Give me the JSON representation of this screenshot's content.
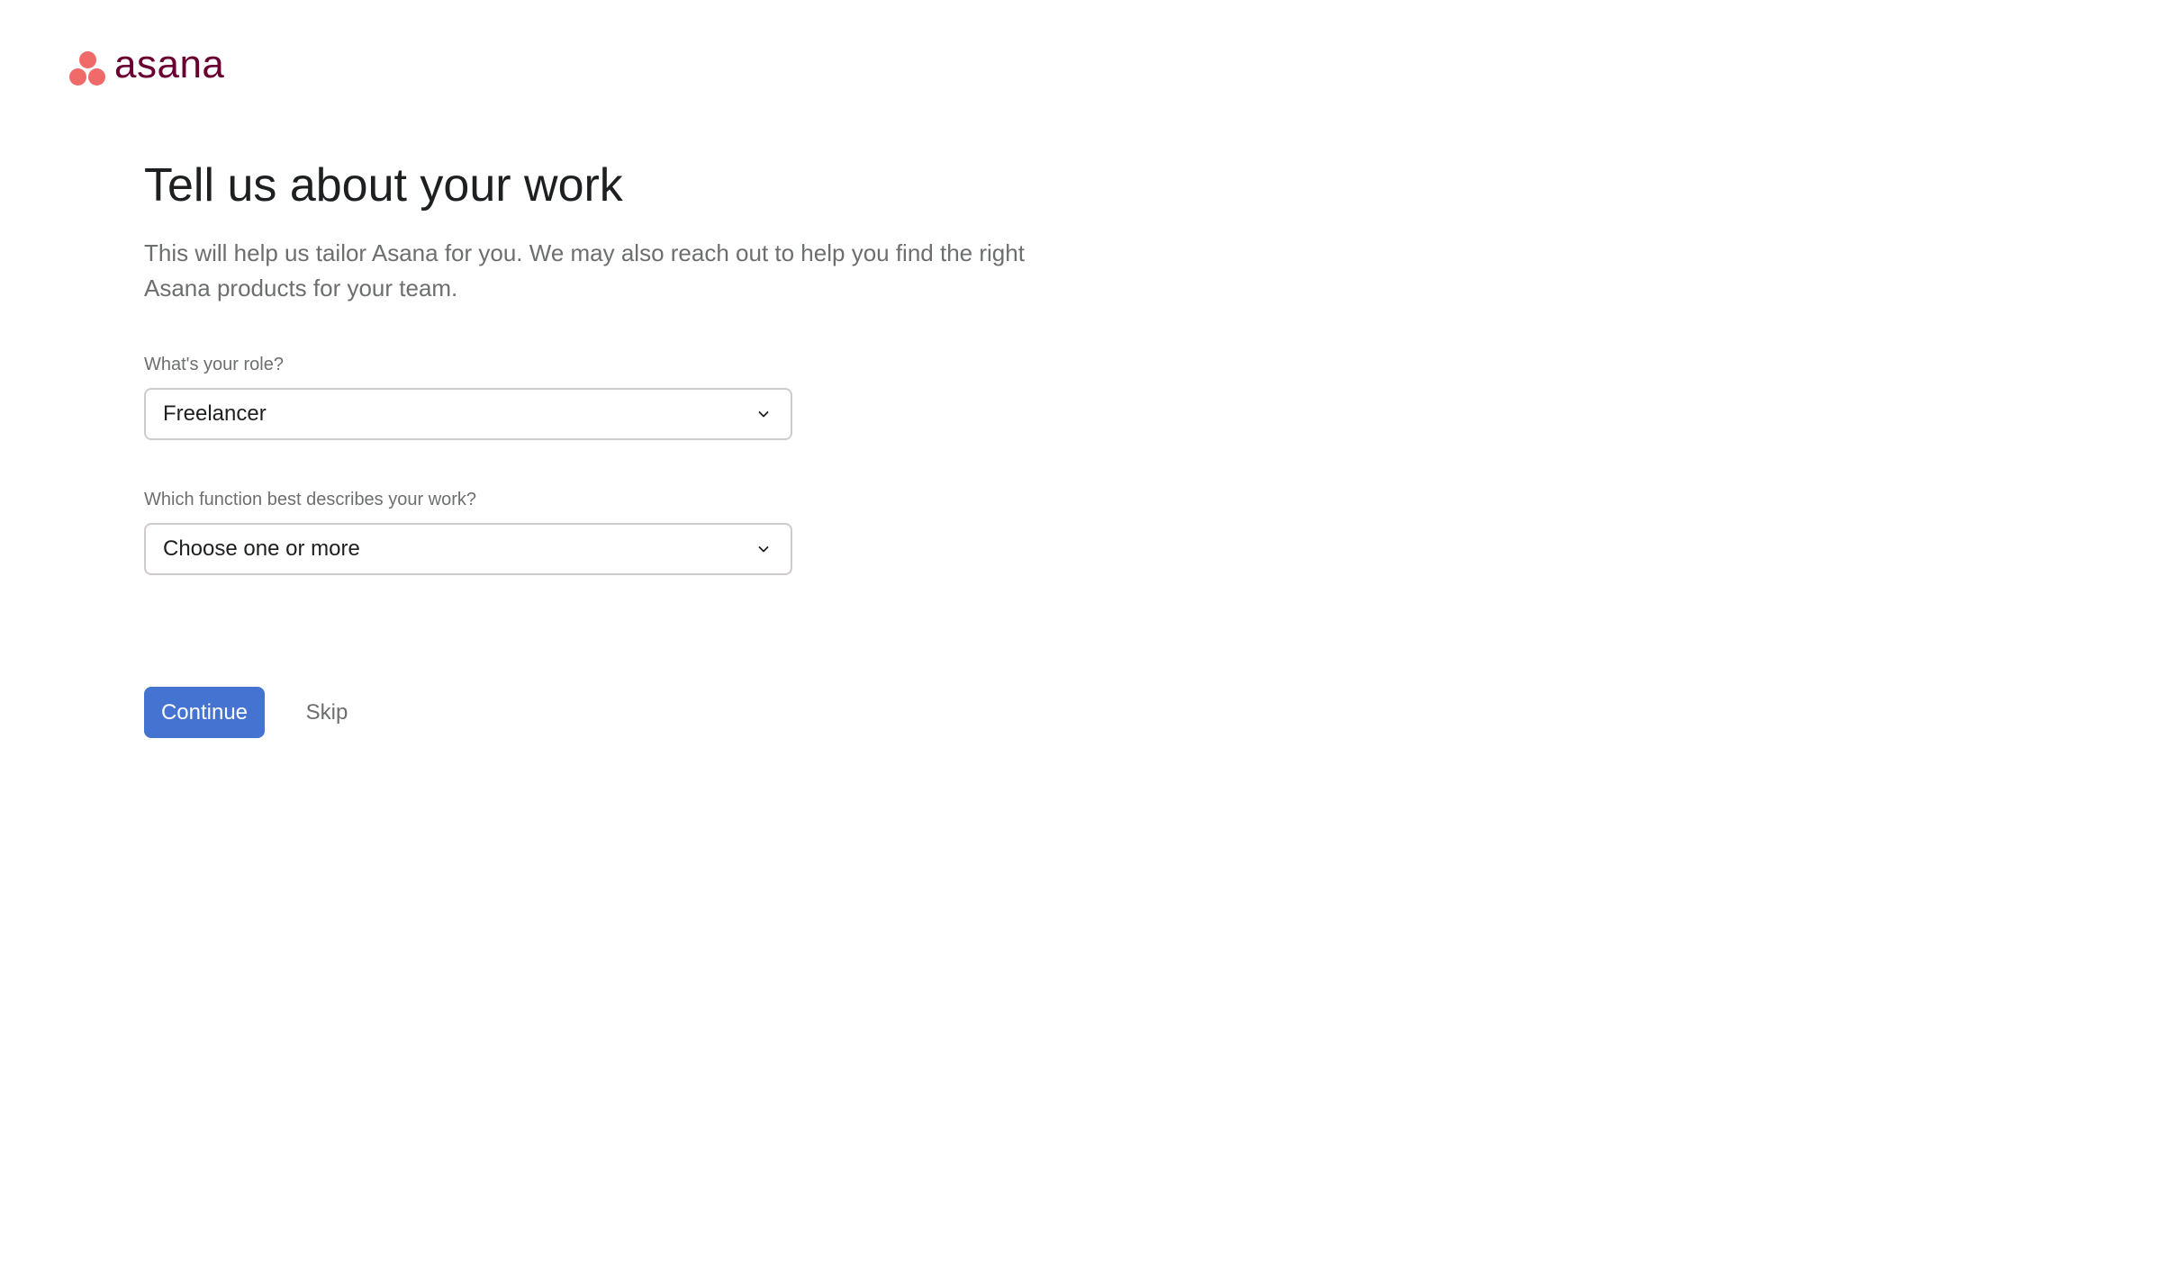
{
  "brand": {
    "name": "asana",
    "logo_icon": "asana-logo-icon",
    "mark_color": "#f06a6a",
    "text_color": "#690031"
  },
  "page": {
    "title": "Tell us about your work",
    "subtitle": "This will help us tailor Asana for you. We may also reach out to help you find the right Asana products for your team."
  },
  "form": {
    "role": {
      "label": "What's your role?",
      "value": "Freelancer",
      "icon": "chevron-down-icon"
    },
    "function": {
      "label": "Which function best describes your work?",
      "placeholder": "Choose one or more",
      "icon": "chevron-down-icon"
    }
  },
  "actions": {
    "continue_label": "Continue",
    "skip_label": "Skip",
    "primary_color": "#4573d2"
  }
}
